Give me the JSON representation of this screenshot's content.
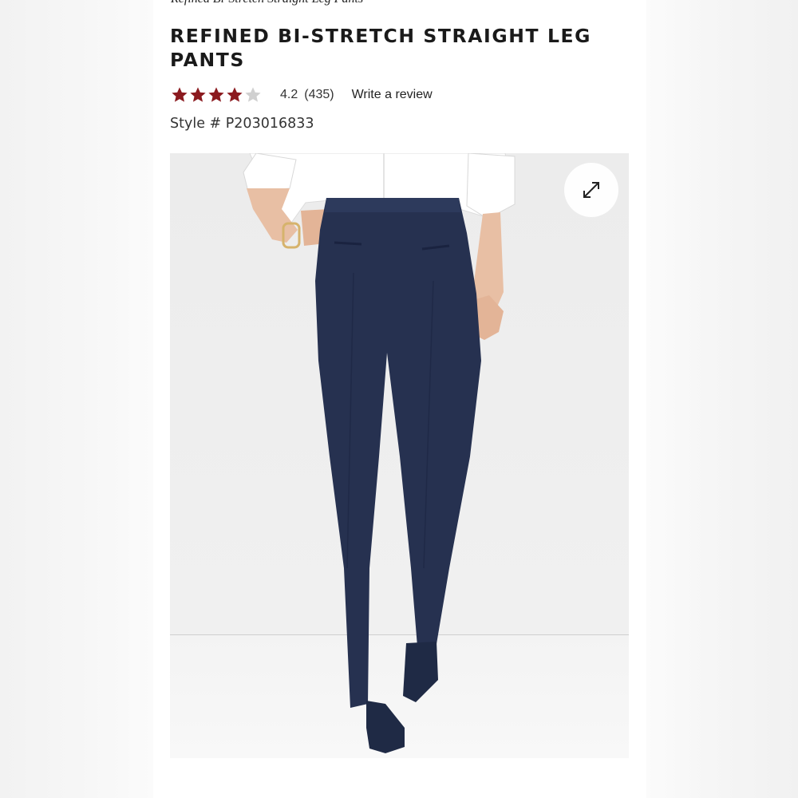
{
  "breadcrumb": "Refined Bi-Stretch Straight Leg Pants",
  "product": {
    "title": "REFINED BI-STRETCH STRAIGHT LEG PANTS",
    "rating_value": "4.2",
    "review_count": "(435)",
    "write_review_label": "Write a review",
    "style_label": "Style # P203016833",
    "rating_stars": 4.2
  },
  "colors": {
    "star_filled": "#8b1a1f",
    "star_empty": "#d0d0d0",
    "pants": "#263150",
    "shirt": "#ffffff"
  },
  "icons": {
    "expand": "expand-arrows-icon"
  }
}
